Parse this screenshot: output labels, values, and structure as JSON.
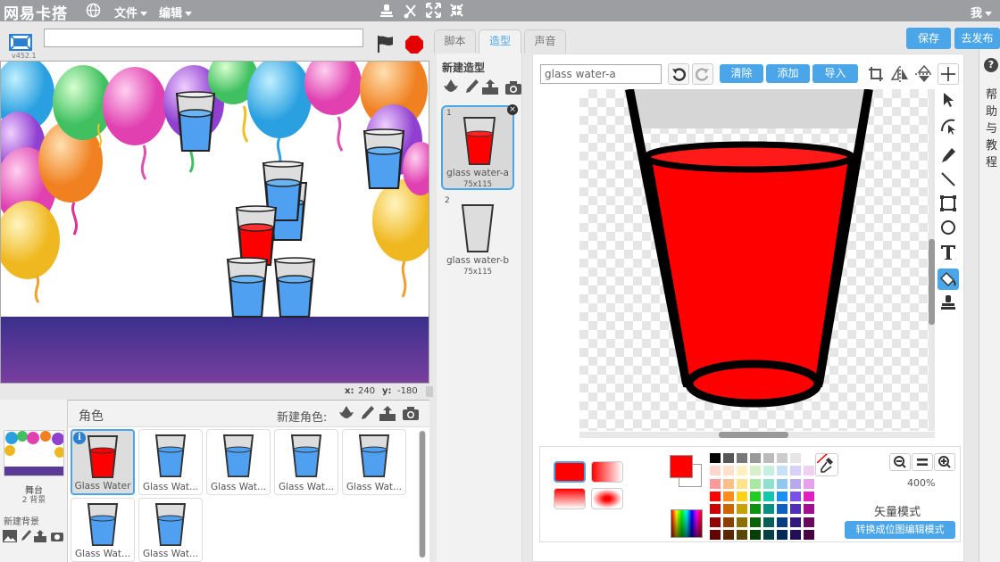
{
  "menubar": {
    "logo": "网易卡搭",
    "file": "文件",
    "edit": "编辑",
    "user": "我"
  },
  "stage": {
    "version": "v452.1",
    "project_title_value": "",
    "coord_x_label": "x:",
    "coord_x": "240",
    "coord_y_label": "y:",
    "coord_y": "-180"
  },
  "sprites": {
    "header": "角色",
    "new_sprite_label": "新建角色:",
    "stage_label": "舞台",
    "backdrop_count": "2 背景",
    "new_backdrop_label": "新建背景",
    "items": [
      {
        "name": "Glass Water",
        "selected": true,
        "water": "red"
      },
      {
        "name": "Glass Wat...",
        "selected": false,
        "water": "blue"
      },
      {
        "name": "Glass Wat...",
        "selected": false,
        "water": "blue"
      },
      {
        "name": "Glass Wat...",
        "selected": false,
        "water": "blue"
      },
      {
        "name": "Glass Wat...",
        "selected": false,
        "water": "blue"
      },
      {
        "name": "Glass Wat...",
        "selected": false,
        "water": "blue"
      },
      {
        "name": "Glass Wat...",
        "selected": false,
        "water": "blue"
      }
    ]
  },
  "tabs": {
    "scripts": "脚本",
    "costumes": "造型",
    "sounds": "声音",
    "active": "costumes"
  },
  "top_buttons": {
    "save": "保存",
    "publish": "去发布"
  },
  "costumes": {
    "header": "新建造型",
    "items": [
      {
        "index": "1",
        "name": "glass water-a",
        "size": "75x115",
        "selected": true
      },
      {
        "index": "2",
        "name": "glass water-b",
        "size": "75x115",
        "selected": false
      }
    ]
  },
  "paint": {
    "costume_name_value": "glass water-a",
    "clear": "清除",
    "add": "添加",
    "import": "导入",
    "zoom": "400%",
    "mode_label": "矢量模式",
    "convert_button": "转换成位图编辑模式",
    "selected_tool": "fill"
  },
  "help": {
    "icon": "?",
    "text": "帮助与教程"
  },
  "colors": {
    "accent": "#4aa6e8",
    "menubar": "#9c9ea1",
    "current_fill": "#ff0000",
    "water_red": "#ff0000",
    "water_blue": "#4fa0f0",
    "stage_floor": "#5a3a96"
  }
}
